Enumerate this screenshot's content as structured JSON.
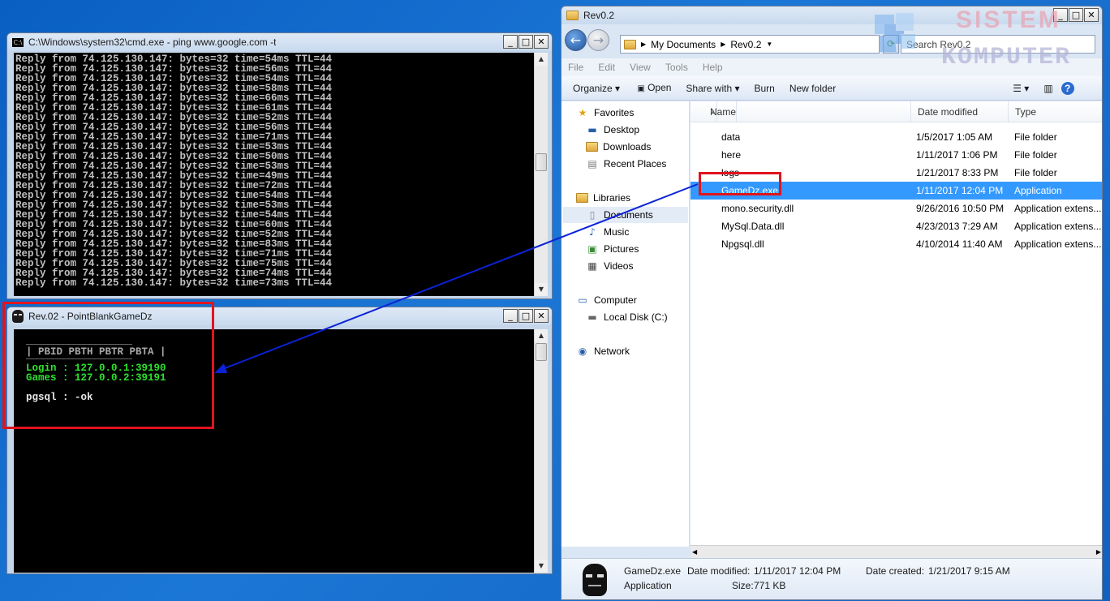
{
  "cmd_window": {
    "title": "C:\\Windows\\system32\\cmd.exe - ping  www.google.com -t",
    "lines": [
      "Reply from 74.125.130.147: bytes=32 time=54ms TTL=44",
      "Reply from 74.125.130.147: bytes=32 time=56ms TTL=44",
      "Reply from 74.125.130.147: bytes=32 time=54ms TTL=44",
      "Reply from 74.125.130.147: bytes=32 time=58ms TTL=44",
      "Reply from 74.125.130.147: bytes=32 time=66ms TTL=44",
      "Reply from 74.125.130.147: bytes=32 time=61ms TTL=44",
      "Reply from 74.125.130.147: bytes=32 time=52ms TTL=44",
      "Reply from 74.125.130.147: bytes=32 time=56ms TTL=44",
      "Reply from 74.125.130.147: bytes=32 time=71ms TTL=44",
      "Reply from 74.125.130.147: bytes=32 time=53ms TTL=44",
      "Reply from 74.125.130.147: bytes=32 time=50ms TTL=44",
      "Reply from 74.125.130.147: bytes=32 time=53ms TTL=44",
      "Reply from 74.125.130.147: bytes=32 time=49ms TTL=44",
      "Reply from 74.125.130.147: bytes=32 time=72ms TTL=44",
      "Reply from 74.125.130.147: bytes=32 time=54ms TTL=44",
      "Reply from 74.125.130.147: bytes=32 time=53ms TTL=44",
      "Reply from 74.125.130.147: bytes=32 time=54ms TTL=44",
      "Reply from 74.125.130.147: bytes=32 time=60ms TTL=44",
      "Reply from 74.125.130.147: bytes=32 time=52ms TTL=44",
      "Reply from 74.125.130.147: bytes=32 time=83ms TTL=44",
      "Reply from 74.125.130.147: bytes=32 time=71ms TTL=44",
      "Reply from 74.125.130.147: bytes=32 time=75ms TTL=44",
      "Reply from 74.125.130.147: bytes=32 time=74ms TTL=44",
      "Reply from 74.125.130.147: bytes=32 time=73ms TTL=44"
    ]
  },
  "game_window": {
    "title": "Rev.02 - PointBlankGameDz",
    "rule": "____________________",
    "header": "| PBID PBTH PBTR PBTA |",
    "login": "Login : 127.0.0.1:39190",
    "games": "Games : 127.0.0.2:39191",
    "pgsql": "pgsql : -ok"
  },
  "explorer": {
    "title": "Rev0.2",
    "breadcrumb": [
      "My Documents",
      "Rev0.2"
    ],
    "search_placeholder": "Search Rev0.2",
    "menu": [
      "File",
      "Edit",
      "View",
      "Tools",
      "Help"
    ],
    "toolbar": {
      "organize": "Organize",
      "open": "Open",
      "share_with": "Share with",
      "burn": "Burn",
      "new_folder": "New folder"
    },
    "nav": {
      "favorites": "Favorites",
      "desktop": "Desktop",
      "downloads": "Downloads",
      "recent_places": "Recent Places",
      "libraries": "Libraries",
      "documents": "Documents",
      "music": "Music",
      "pictures": "Pictures",
      "videos": "Videos",
      "computer": "Computer",
      "local_disk": "Local Disk (C:)",
      "network": "Network"
    },
    "columns": {
      "name": "Name",
      "date_modified": "Date modified",
      "type": "Type"
    },
    "files": [
      {
        "name": "data",
        "date": "1/5/2017 1:05 AM",
        "type": "File folder",
        "icon": "folder"
      },
      {
        "name": "here",
        "date": "1/11/2017 1:06 PM",
        "type": "File folder",
        "icon": "folder"
      },
      {
        "name": "logs",
        "date": "1/21/2017 8:33 PM",
        "type": "File folder",
        "icon": "folder"
      },
      {
        "name": "GameDz.exe",
        "date": "1/11/2017 12:04 PM",
        "type": "Application",
        "icon": "mask",
        "selected": true
      },
      {
        "name": "mono.security.dll",
        "date": "9/26/2016 10:50 PM",
        "type": "Application extens...",
        "icon": "dll"
      },
      {
        "name": "MySql.Data.dll",
        "date": "4/23/2013 7:29 AM",
        "type": "Application extens...",
        "icon": "dll"
      },
      {
        "name": "Npgsql.dll",
        "date": "4/10/2014 11:40 AM",
        "type": "Application extens...",
        "icon": "dll"
      }
    ],
    "details": {
      "name": "GameDz.exe",
      "date_modified_label": "Date modified:",
      "date_modified": "1/11/2017 12:04 PM",
      "date_created_label": "Date created:",
      "date_created": "1/21/2017 9:15 AM",
      "type": "Application",
      "size_label": "Size:",
      "size": "771 KB"
    }
  },
  "watermark": {
    "line1": "SISTEM",
    "line2": "KOMPUTER"
  },
  "colors": {
    "accent_select": "#3399ff",
    "console_green": "#2de22d",
    "highlight_red": "#e0141e",
    "arrow_blue": "#0b22d8"
  }
}
